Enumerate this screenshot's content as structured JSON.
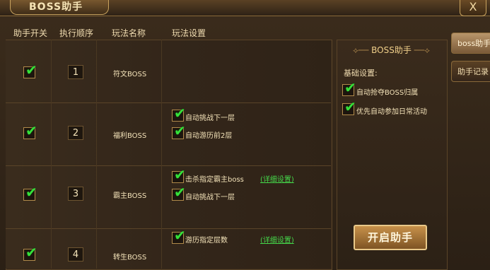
{
  "window": {
    "title": "BOSS助手",
    "close_label": "X"
  },
  "columns": [
    "助手开关",
    "执行顺序",
    "玩法名称",
    "玩法设置"
  ],
  "rows": [
    {
      "order": "1",
      "name": "符文BOSS",
      "options": [],
      "link": ""
    },
    {
      "order": "2",
      "name": "福利BOSS",
      "options": [
        "自动挑战下一层",
        "自动游历前2层"
      ],
      "link": ""
    },
    {
      "order": "3",
      "name": "霸主BOSS",
      "options": [
        "击杀指定霸主boss",
        "自动挑战下一层"
      ],
      "link": "(详细设置)"
    },
    {
      "order": "4",
      "name": "转生BOSS",
      "options": [
        "游历指定层数"
      ],
      "link": "(详细设置)"
    }
  ],
  "panel": {
    "title": "BOSS助手",
    "section_label": "基础设置:",
    "settings": [
      "自动抢夺BOSS归属",
      "优先自动参加日常活动"
    ],
    "start_button": "开启助手"
  },
  "side_tabs": [
    "boss助手",
    "助手记录"
  ],
  "colors": {
    "check": "#35e03a",
    "link": "#45d84a",
    "gold_border": "#c9a35e"
  }
}
